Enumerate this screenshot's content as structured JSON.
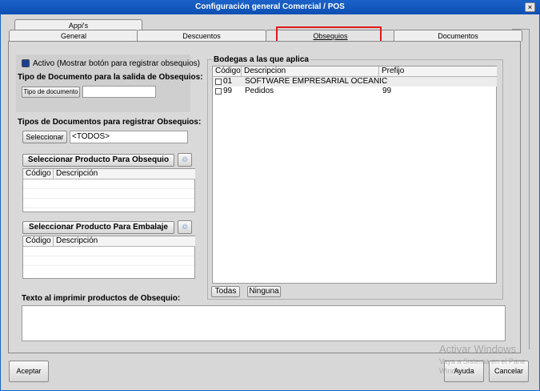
{
  "window": {
    "title": "Configuración general Comercial / POS",
    "close_symbol": "×"
  },
  "tabs": {
    "apps": "Appi's",
    "general": "General",
    "descuentos": "Descuentos",
    "obsequios": "Obsequios",
    "documentos": "Documentos"
  },
  "left": {
    "activo_label": "Activo (Mostrar botón para registrar obsequios)",
    "tipo_doc_salida_heading": "Tipo de Documento para la salida de Obsequios:",
    "tipo_documento_button": "Tipo de documento",
    "tipo_documento_value": "",
    "tipos_registrar_heading": "Tipos de Documentos para registrar Obsequios:",
    "seleccionar_button": "Seleccionar",
    "seleccionar_value": "<TODOS>",
    "producto_obsequio_button": "Seleccionar Producto Para Obsequio",
    "producto_embalaje_button": "Seleccionar Producto Para Embalaje",
    "grid_columns": {
      "codigo": "Código",
      "descripcion": "Descripción"
    },
    "texto_imprimir_label": "Texto al imprimir productos de Obsequio:",
    "texto_imprimir_value": ""
  },
  "bodegas": {
    "title": "Bodegas a las que aplica",
    "columns": {
      "codigo": "Código",
      "descripcion": "Descripcion",
      "prefijo": "Prefijo"
    },
    "rows": [
      {
        "codigo": "01",
        "descripcion": "SOFTWARE EMPRESARIAL OCEANIC",
        "prefijo": ".",
        "checked": false
      },
      {
        "codigo": "99",
        "descripcion": "Pedidos",
        "prefijo": "99",
        "checked": false
      }
    ],
    "todas_button": "Todas",
    "ninguna_button": "Ninguna"
  },
  "footer": {
    "aceptar_button": "Aceptar",
    "ayuda_button": "Ayuda",
    "cancelar_button": "Cancelar"
  },
  "watermark": {
    "line1": "Activar Windows",
    "line2": "Vaya a Sistema en el Pane",
    "line3": "Windo"
  },
  "colors": {
    "title_bar": "#1b62c8",
    "highlight": "#e01a1a",
    "active_radio": "#1b3f8f"
  }
}
